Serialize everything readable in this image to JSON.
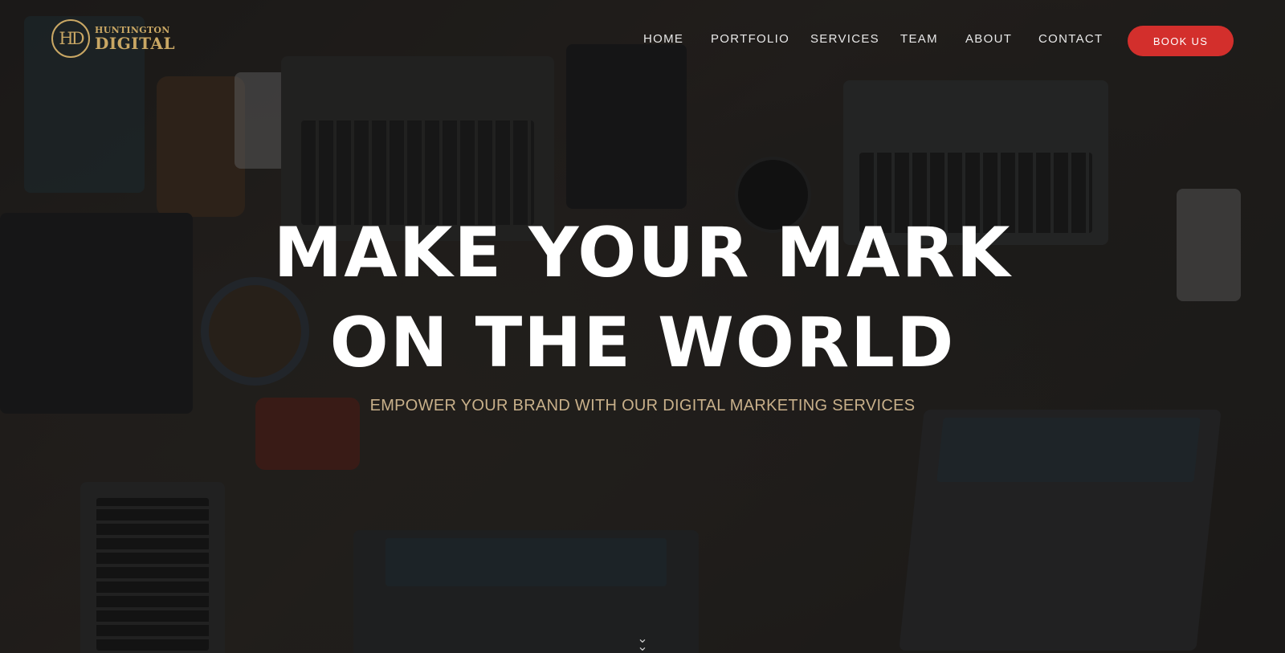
{
  "brand": {
    "monogram": "HD",
    "name_top": "HUNTINGTON",
    "name_bottom": "DIGITAL",
    "color": "#c9a764"
  },
  "nav": {
    "items": [
      {
        "label": "HOME"
      },
      {
        "label": "PORTFOLIO"
      },
      {
        "label": "SERVICES"
      },
      {
        "label": "TEAM"
      },
      {
        "label": "ABOUT"
      },
      {
        "label": "CONTACT"
      }
    ],
    "cta_label": "BOOK US",
    "cta_color": "#d32f2c"
  },
  "hero": {
    "headline_line1": "MAKE YOUR MARK",
    "headline_line2": "ON THE WORLD",
    "tagline": "EMPOWER YOUR BRAND WITH OUR DIGITAL MARKETING SERVICES",
    "tagline_color": "#c8b08a",
    "scroll_icon": "double-chevron-down-icon"
  }
}
